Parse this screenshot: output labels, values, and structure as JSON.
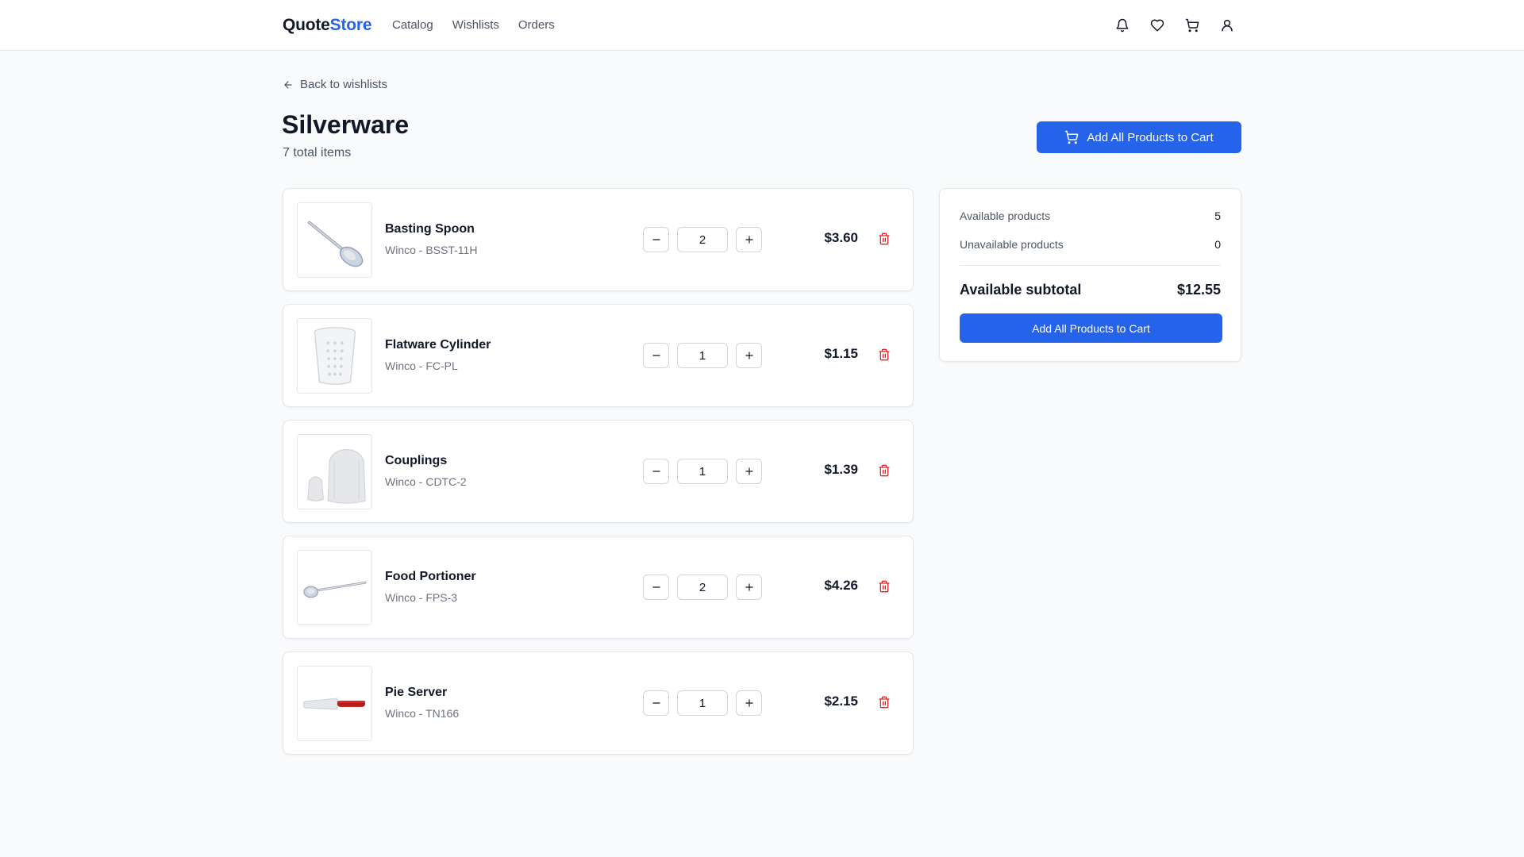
{
  "header": {
    "brand_part1": "Quote",
    "brand_part2": "Store",
    "nav": [
      "Catalog",
      "Wishlists",
      "Orders"
    ],
    "icons": [
      "bell-icon",
      "heart-icon",
      "cart-icon",
      "user-icon"
    ]
  },
  "page": {
    "back_label": "Back to wishlists",
    "title": "Silverware",
    "subtitle": "7 total items",
    "top_cta_label": "Add All Products to Cart"
  },
  "items": [
    {
      "name": "Basting Spoon",
      "meta": "Winco - BSST-11H",
      "qty": "2",
      "price": "$3.60",
      "image": "basting-spoon"
    },
    {
      "name": "Flatware Cylinder",
      "meta": "Winco - FC-PL",
      "qty": "1",
      "price": "$1.15",
      "image": "flatware-cylinder"
    },
    {
      "name": "Couplings",
      "meta": "Winco - CDTC-2",
      "qty": "1",
      "price": "$1.39",
      "image": "couplings"
    },
    {
      "name": "Food Portioner",
      "meta": "Winco - FPS-3",
      "qty": "2",
      "price": "$4.26",
      "image": "food-portioner"
    },
    {
      "name": "Pie Server",
      "meta": "Winco - TN166",
      "qty": "1",
      "price": "$2.15",
      "image": "pie-server"
    }
  ],
  "summary": {
    "available_label": "Available products",
    "available_value": "5",
    "unavailable_label": "Unavailable products",
    "unavailable_value": "0",
    "subtotal_label": "Available subtotal",
    "subtotal_value": "$12.55",
    "cta_label": "Add All Products to Cart"
  },
  "colors": {
    "accent": "#2563eb",
    "danger": "#dc2626",
    "background": "#f9fafb"
  }
}
